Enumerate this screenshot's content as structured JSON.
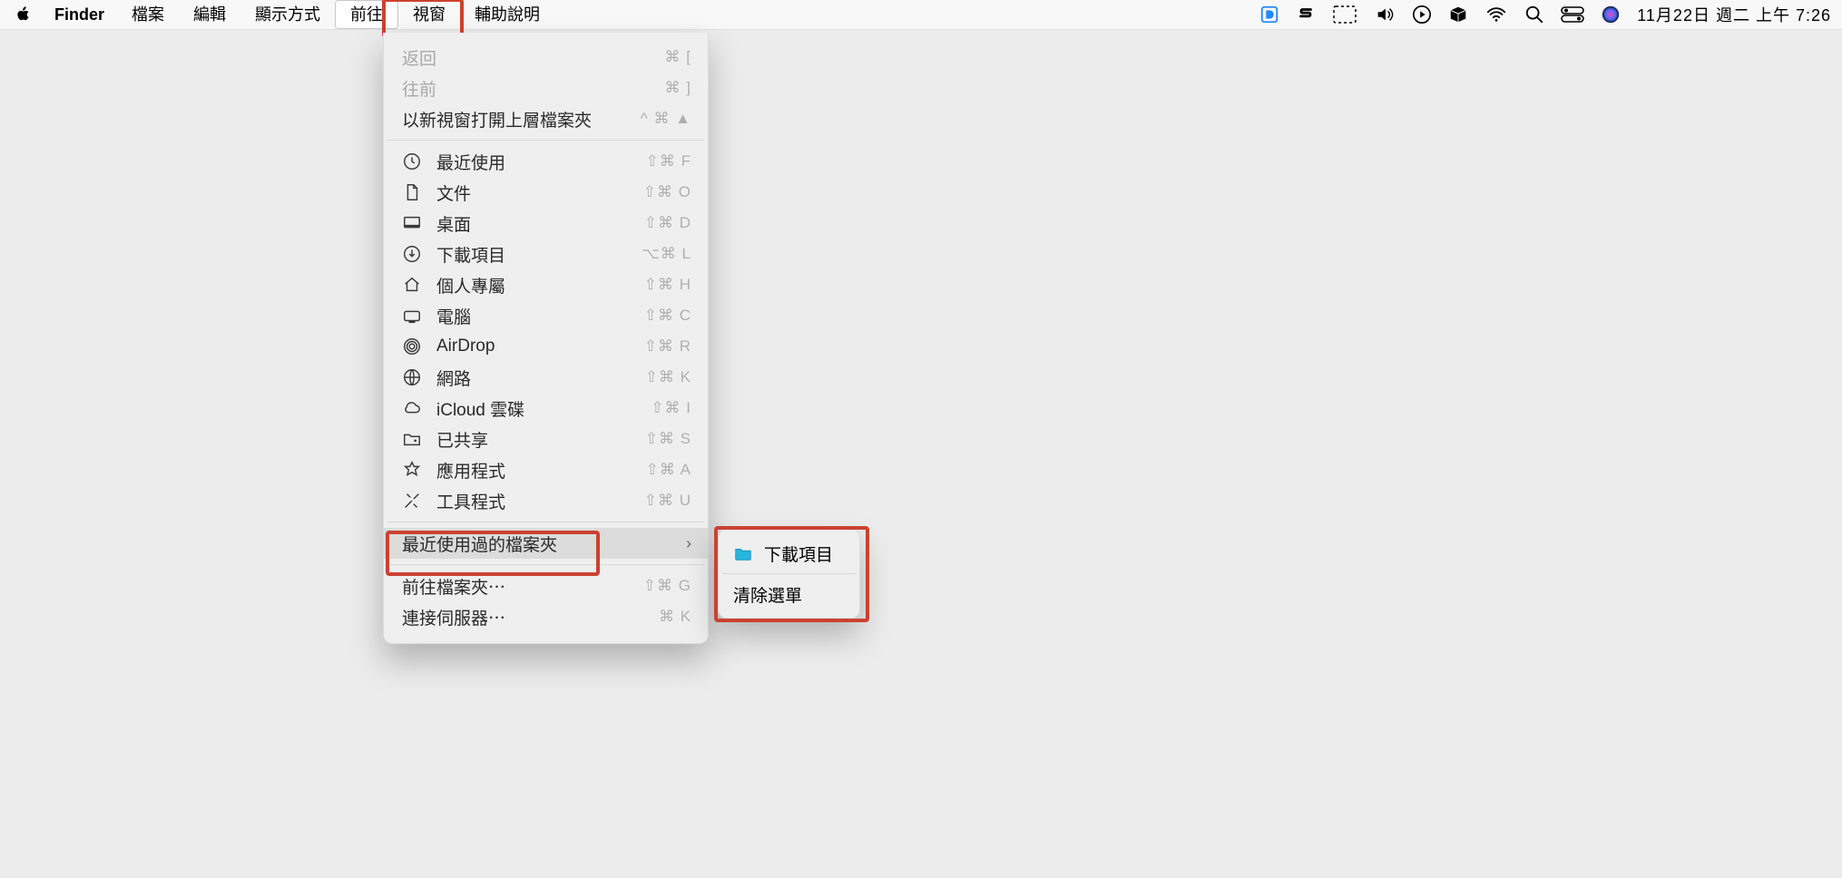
{
  "menubar": {
    "app": "Finder",
    "items": [
      "檔案",
      "編輯",
      "顯示方式",
      "前往",
      "視窗",
      "輔助說明"
    ],
    "open_index": 3,
    "clock": "11月22日 週二  上午 7:26"
  },
  "menu": {
    "back": {
      "label": "返回",
      "shortcut": "⌘ ["
    },
    "forward": {
      "label": "往前",
      "shortcut": "⌘ ]"
    },
    "enclosing": {
      "label": "以新視窗打開上層檔案夾",
      "shortcut": "^ ⌘ ▲"
    },
    "recent": {
      "label": "最近使用",
      "shortcut": "⇧⌘ F"
    },
    "documents": {
      "label": "文件",
      "shortcut": "⇧⌘ O"
    },
    "desktop": {
      "label": "桌面",
      "shortcut": "⇧⌘ D"
    },
    "downloads": {
      "label": "下載項目",
      "shortcut": "⌥⌘ L"
    },
    "home": {
      "label": "個人專屬",
      "shortcut": "⇧⌘ H"
    },
    "computer": {
      "label": "電腦",
      "shortcut": "⇧⌘ C"
    },
    "airdrop": {
      "label": "AirDrop",
      "shortcut": "⇧⌘ R"
    },
    "network": {
      "label": "網路",
      "shortcut": "⇧⌘ K"
    },
    "icloud": {
      "label": "iCloud 雲碟",
      "shortcut": "⇧⌘ I"
    },
    "shared": {
      "label": "已共享",
      "shortcut": "⇧⌘ S"
    },
    "applications": {
      "label": "應用程式",
      "shortcut": "⇧⌘ A"
    },
    "utilities": {
      "label": "工具程式",
      "shortcut": "⇧⌘ U"
    },
    "recent_folders": {
      "label": "最近使用過的檔案夾"
    },
    "goto_folder": {
      "label": "前往檔案夾⋯",
      "shortcut": "⇧⌘ G"
    },
    "connect_server": {
      "label": "連接伺服器⋯",
      "shortcut": "⌘ K"
    }
  },
  "submenu": {
    "downloads": {
      "label": "下載項目"
    },
    "clear": {
      "label": "清除選單"
    }
  },
  "colors": {
    "highlight": "#cc4131",
    "folder": "#28b6de"
  }
}
